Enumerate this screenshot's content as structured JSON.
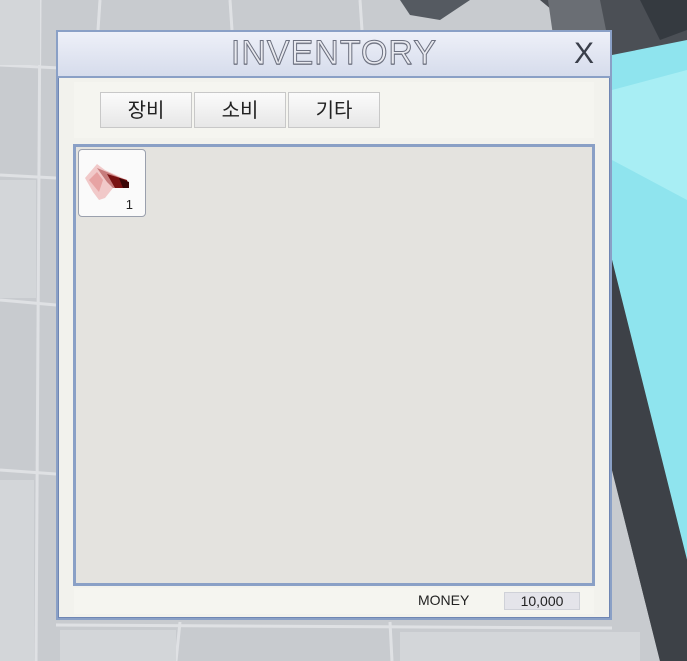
{
  "window": {
    "title": "INVENTORY",
    "close_label": "X"
  },
  "tabs": [
    {
      "label": "장비"
    },
    {
      "label": "소비"
    },
    {
      "label": "기타"
    }
  ],
  "items": [
    {
      "icon": "feather-item-icon",
      "count": "1"
    }
  ],
  "footer": {
    "money_label": "MONEY",
    "money_value": "10,000"
  },
  "colors": {
    "window_border": "#8aa0c6",
    "grid_background": "#e4e3df",
    "water": "#8fe4ee"
  }
}
